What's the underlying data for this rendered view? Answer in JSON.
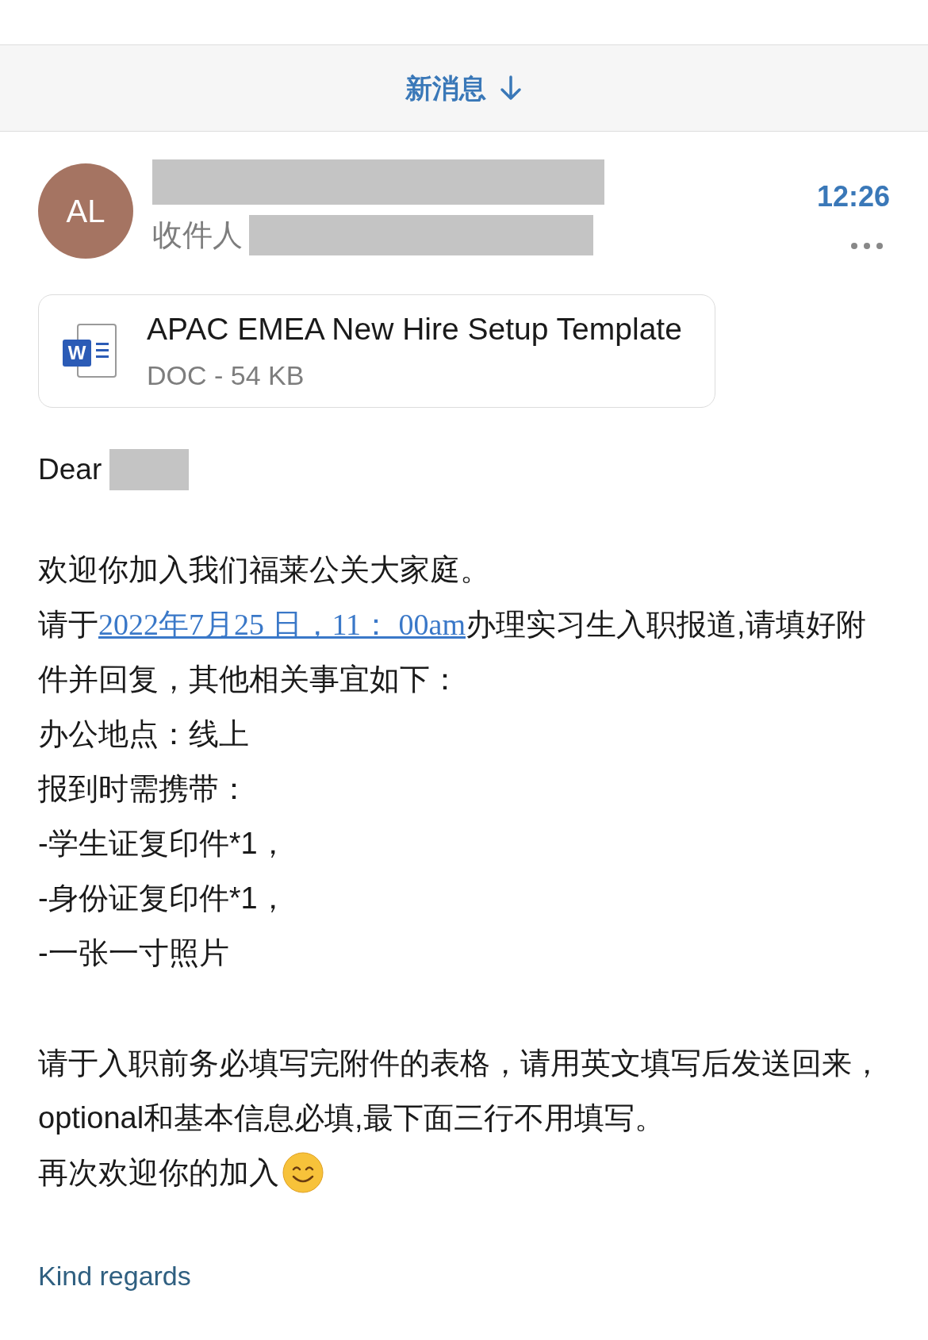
{
  "banner": {
    "label": "新消息"
  },
  "message": {
    "avatar_initials": "AL",
    "sender": {
      "redacted": true
    },
    "recipient_label": "收件人",
    "recipient": {
      "redacted": true
    },
    "time": "12:26"
  },
  "attachment": {
    "icon_label": "W",
    "name": "APAC EMEA New Hire Setup Template",
    "meta": "DOC - 54 KB"
  },
  "greeting": {
    "text": "Dear",
    "name_redacted": true
  },
  "paragraphs": [
    [
      {
        "kind": "text",
        "text": "欢迎你加入我们福莱公关大家庭。"
      },
      {
        "kind": "link",
        "before": "请于",
        "link": "2022年7月25 日，11： 00am",
        "after": "办理实习生入职报道,请填好附件并回复，其他相关事宜如下："
      },
      {
        "kind": "text",
        "text": "办公地点：线上"
      },
      {
        "kind": "text",
        "text": "报到时需携带："
      },
      {
        "kind": "text",
        "text": "-学生证复印件*1，"
      },
      {
        "kind": "text",
        "text": "-身份证复印件*1，"
      },
      {
        "kind": "text",
        "text": "-一张一寸照片"
      }
    ],
    [
      {
        "kind": "text",
        "text": "请于入职前务必填写完附件的表格，请用英文填写后发送回来，optional和基本信息必填,最下面三行不用填写。"
      },
      {
        "kind": "emoji",
        "text": "再次欢迎你的加入"
      }
    ]
  ],
  "signoff": "Kind regards"
}
